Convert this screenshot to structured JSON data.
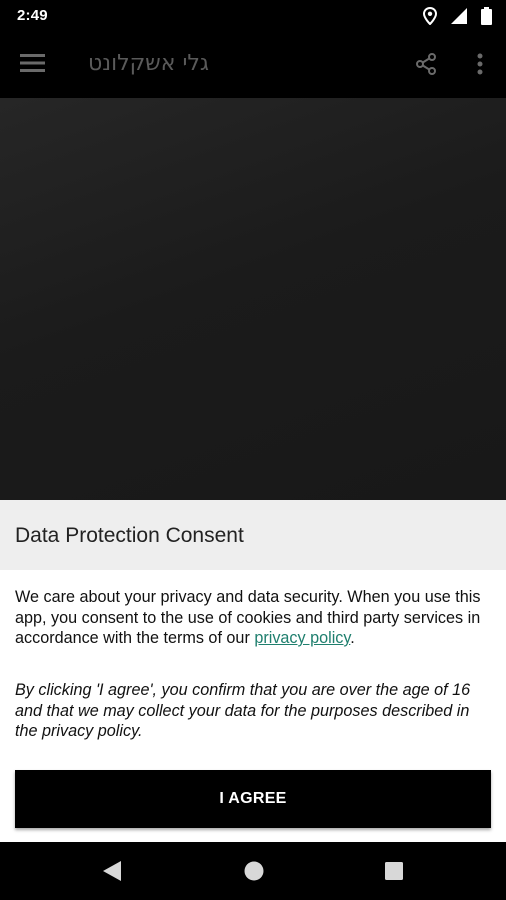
{
  "status_bar": {
    "time": "2:49",
    "icons": [
      "location-icon",
      "signal-icon",
      "battery-icon"
    ]
  },
  "toolbar": {
    "title": "גלי אשקלונט",
    "icons": [
      "menu-icon",
      "share-icon",
      "more-vert-icon"
    ]
  },
  "consent_dialog": {
    "title": "Data Protection Consent",
    "body_text": "We care about your privacy and data security. When you use this app, you consent to the use of cookies and third party services in accordance with the terms of our ",
    "privacy_link": "privacy policy",
    "body_end": ".",
    "note": "By clicking 'I agree', you confirm that you are over the age of 16 and that we may collect your data for the purposes described in the privacy policy.",
    "agree_button": "I AGREE"
  },
  "nav_bar": {
    "icons": [
      "back-icon",
      "home-icon",
      "recents-icon"
    ]
  },
  "colors": {
    "link": "#1f7f6e",
    "header_bg": "#eeeeee",
    "button_bg": "#000000"
  }
}
